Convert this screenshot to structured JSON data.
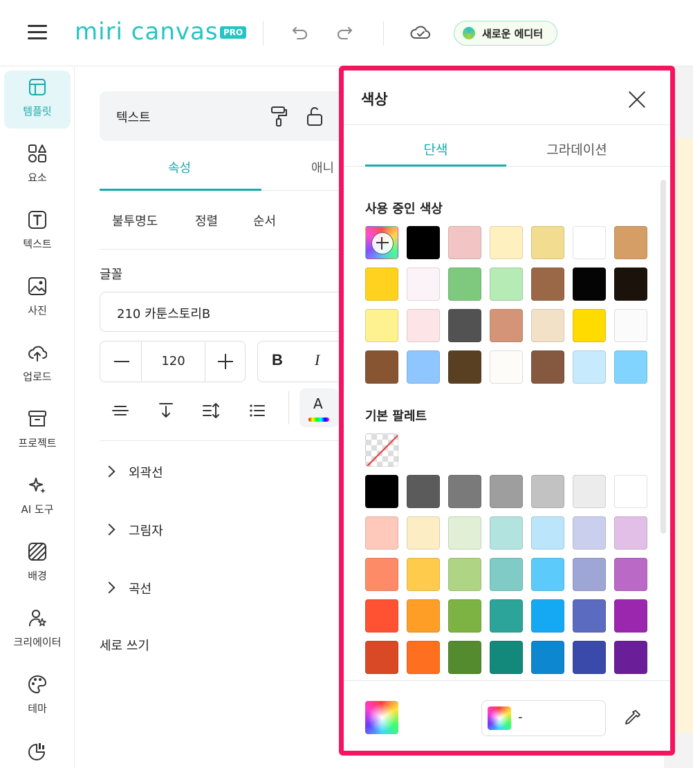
{
  "app": {
    "logo_text": "miri canvas",
    "logo_badge": "PRO",
    "new_editor_label": "새로운 에디터",
    "brand_color": "#26c4c4"
  },
  "rail": {
    "items": [
      {
        "label": "템플릿",
        "icon": "layout-icon"
      },
      {
        "label": "요소",
        "icon": "shapes-icon"
      },
      {
        "label": "텍스트",
        "icon": "text-box-icon"
      },
      {
        "label": "사진",
        "icon": "image-icon"
      },
      {
        "label": "업로드",
        "icon": "cloud-upload-icon"
      },
      {
        "label": "프로젝트",
        "icon": "archive-box-icon"
      },
      {
        "label": "AI 도구",
        "icon": "sparkle-icon"
      },
      {
        "label": "배경",
        "icon": "hatch-background-icon"
      },
      {
        "label": "크리에이터",
        "icon": "creator-star-icon"
      },
      {
        "label": "테마",
        "icon": "palette-icon"
      }
    ]
  },
  "props": {
    "header_title": "텍스트",
    "tabs": [
      "속성",
      "애니"
    ],
    "subtabs": [
      "불투명도",
      "정렬",
      "순서"
    ],
    "font_label": "글꼴",
    "font_value": "210 카툰스토리B",
    "font_size": "120",
    "bold_label": "B",
    "italic_label": "I",
    "color_glyph": "A",
    "expanders": [
      "외곽선",
      "그림자",
      "곡선"
    ],
    "vertical_label": "세로 쓰기"
  },
  "color_panel": {
    "title": "색상",
    "tabs": [
      "단색",
      "그라데이션"
    ],
    "used_label": "사용 중인 색상",
    "used_colors": [
      "#000000",
      "#f2c4c4",
      "#fff0c0",
      "#f1dc8f",
      "#ffffff",
      "#d59e67",
      "#ffd21f",
      "#fcf3f8",
      "#7ec97e",
      "#b6ebb5",
      "#9a6846",
      "#040404",
      "#1b120b",
      "#fef190",
      "#fde5e7",
      "#525252",
      "#d39478",
      "#f2e1c6",
      "#ffdb00",
      "#fbfbfb",
      "#885533",
      "#8fc6ff",
      "#5a4023",
      "#fefcf8",
      "#855840",
      "#c7eafd",
      "#80d4fd"
    ],
    "basic_label": "기본 팔레트",
    "basic_colors": [
      [
        "#000000",
        "#5b5b5b",
        "#7a7a7a",
        "#9e9e9e",
        "#c2c2c2",
        "#ececec",
        "#ffffff"
      ],
      [
        "#fec9bb",
        "#fdedc4",
        "#e0efd6",
        "#b3e3df",
        "#bae5fa",
        "#cbcfee",
        "#e1bfe6"
      ],
      [
        "#fe8b67",
        "#fecb4d",
        "#afd584",
        "#80cbc5",
        "#5ccbfc",
        "#9ea6d6",
        "#ba69c6"
      ],
      [
        "#fe5232",
        "#fe9e26",
        "#7db342",
        "#2ca49a",
        "#16a9f3",
        "#5b6bbf",
        "#9b27af"
      ],
      [
        "#d94926",
        "#fe6f1f",
        "#558b2f",
        "#12897b",
        "#0d87d0",
        "#3a4aaa",
        "#6a1f99"
      ]
    ],
    "hex_value": "-"
  }
}
